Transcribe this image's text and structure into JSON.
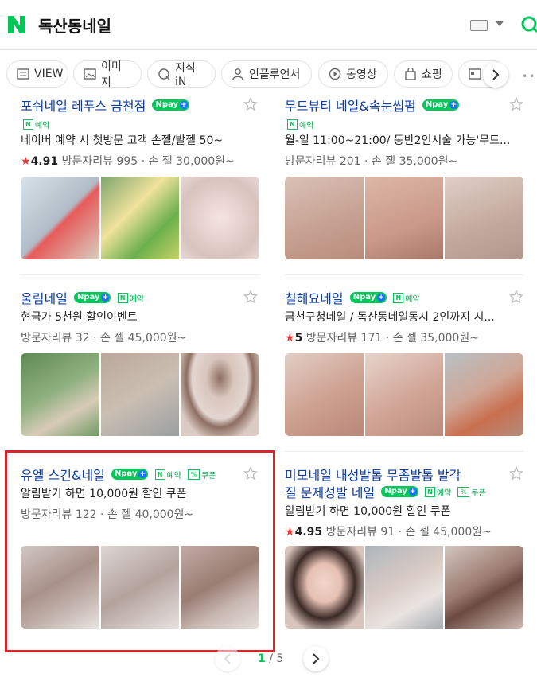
{
  "header": {
    "query": "독산동네일"
  },
  "tabs": [
    {
      "label": "VIEW",
      "icon": "view-icon"
    },
    {
      "label": "이미지",
      "icon": "image-icon"
    },
    {
      "label": "지식iN",
      "icon": "knowledge-icon"
    },
    {
      "label": "인플루언서",
      "icon": "person-icon"
    },
    {
      "label": "동영상",
      "icon": "play-icon"
    },
    {
      "label": "쇼핑",
      "icon": "shopping-bag-icon"
    }
  ],
  "badges": {
    "pay": "pay",
    "reservation": "예약",
    "coupon": "쿠폰",
    "n": "N",
    "coupon_mark": "%"
  },
  "cards": [
    {
      "name": "포쉬네일 레푸스 금천점",
      "line1": "네이버 예약 시 첫방문 고객 손젤/발젤 50~",
      "score": "4.91",
      "meta": "방문자리뷰 995 · 손 젤 30,000원~",
      "images": [
        "#c0c8d2",
        "#e7d9a2",
        "#ead8d4"
      ]
    },
    {
      "name": "무드뷰티 네일&속눈썹펌",
      "line1": "월-일 11:00~21:00/ 동반2인시술 가능'무드...",
      "score": "",
      "meta": "방문자리뷰 201 · 손 젤 35,000원~",
      "images": [
        "#c9b2a6",
        "#caa596",
        "#cab1a6"
      ]
    },
    {
      "name": "울림네일",
      "line1": "현금가 5천원 할인이벤트",
      "score": "",
      "meta": "방문자리뷰 32 · 손 젤 45,000원~",
      "images": [
        "#8fa67f",
        "#c5b7a8",
        "#d6c7c2"
      ]
    },
    {
      "name": "칠해요네일",
      "line1": "금천구청네일 / 독산동네일동시 2인까지 시...",
      "score": "5",
      "meta": "방문자리뷰 171 · 손 젤 35,000원~",
      "images": [
        "#cdaaa0",
        "#d2b4aa",
        "#c9a79b"
      ]
    },
    {
      "name": "유엘 스킨&네일",
      "line1": "알림받기 하면 10,000원 할인 쿠폰",
      "score": "",
      "meta": "방문자리뷰 122 · 손 젤 40,000원~",
      "images": [
        "#b8a6a2",
        "#c6b9b4",
        "#b49d97"
      ]
    },
    {
      "name1": "미모네일 내성발톱 무좀발톱 발각",
      "name2": "질 문제성발 네일",
      "line1": "알림받기 하면 10,000원 할인 쿠폰",
      "score": "4.95",
      "meta": "방문자리뷰 91 · 손 젤 45,000원~",
      "images": [
        "#d7c1b8",
        "#c2c6cc",
        "#b59f95"
      ]
    }
  ],
  "pagination": {
    "current": "1",
    "total": "/ 5"
  },
  "colors": {
    "naver_green": "#03c75a",
    "title_blue": "#0d3ea8",
    "highlight_red": "#d9262c",
    "star_red": "#e53935"
  }
}
